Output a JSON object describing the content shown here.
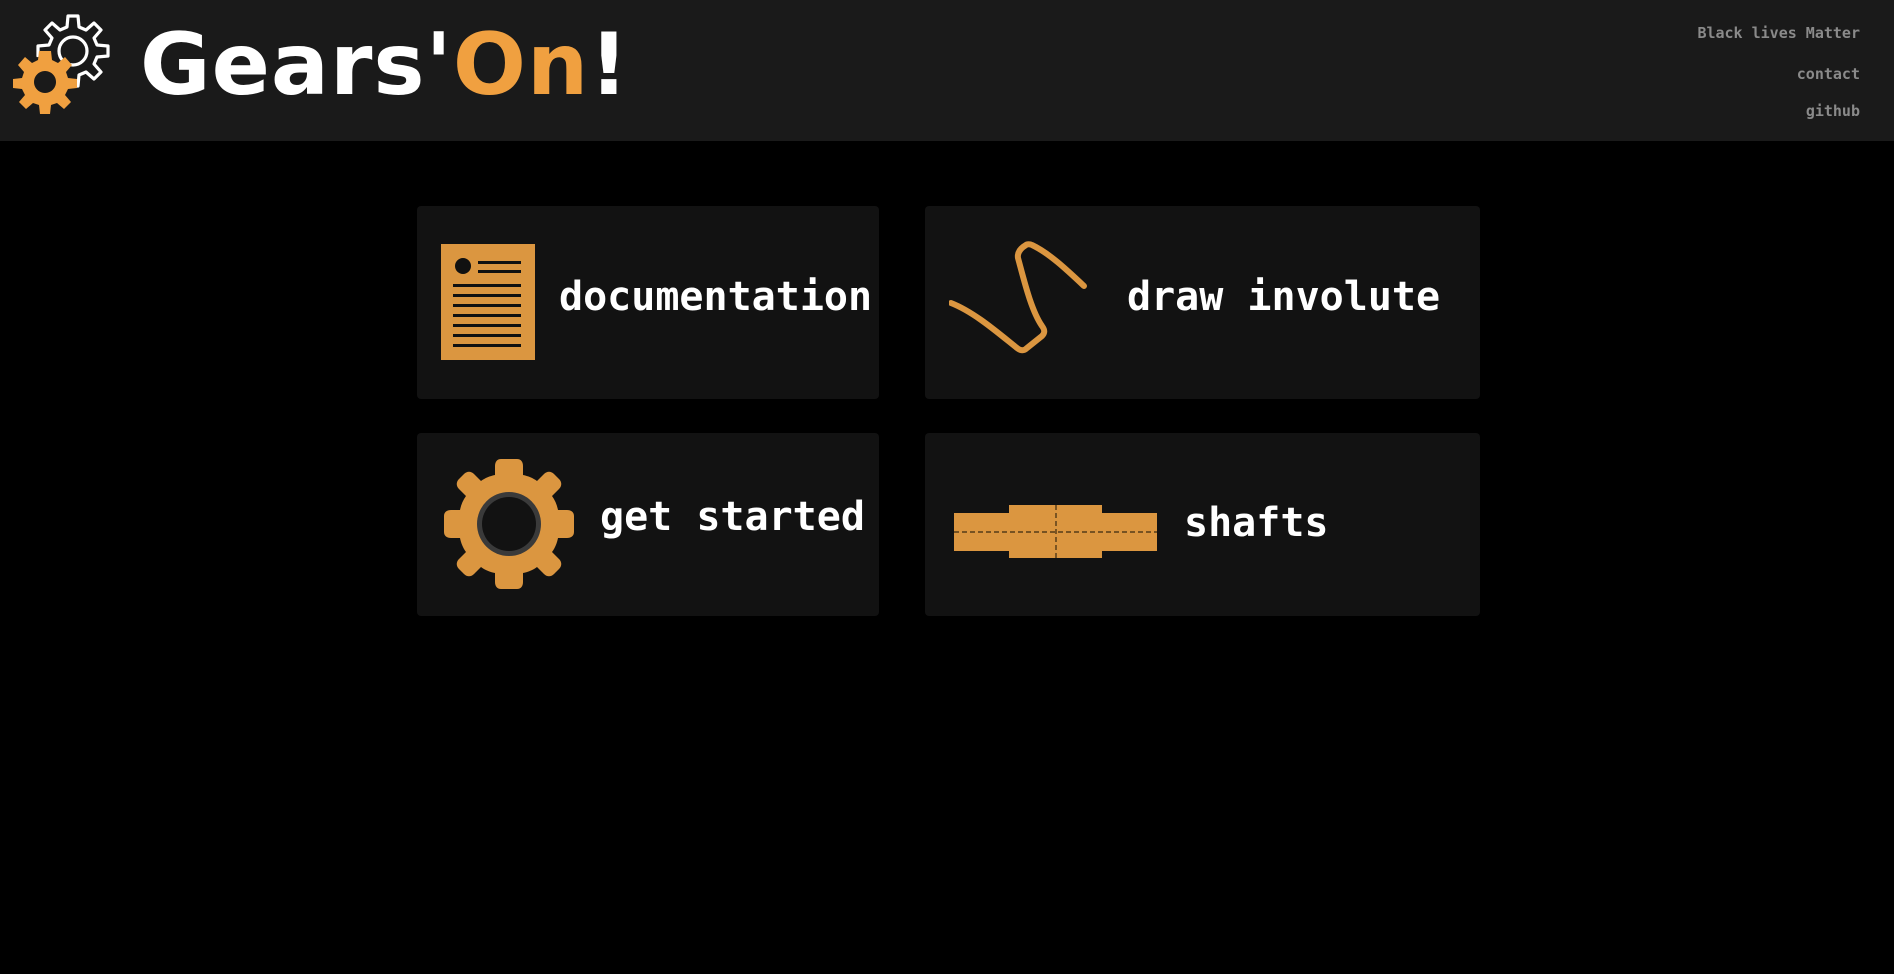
{
  "header": {
    "logo": {
      "text_main": "Gears'",
      "text_accent": "On",
      "text_end": "!",
      "icon": "gears-icon"
    },
    "links": {
      "blm": "Black lives Matter",
      "contact": "contact",
      "github": "github"
    }
  },
  "cards": {
    "documentation": {
      "label": "documentation",
      "icon": "document-icon"
    },
    "involute": {
      "label": "draw involute",
      "icon": "involute-curve-icon"
    },
    "get_started": {
      "label": "get started",
      "icon": "gear-icon"
    },
    "shafts": {
      "label": "shafts",
      "icon": "shaft-icon"
    }
  },
  "colors": {
    "background": "#000000",
    "header_bg": "#1a1a1a",
    "card_bg": "#121212",
    "accent": "#f0a040",
    "icon_fill": "#db9640",
    "text": "#ffffff",
    "link_text": "#8a8a8a"
  }
}
